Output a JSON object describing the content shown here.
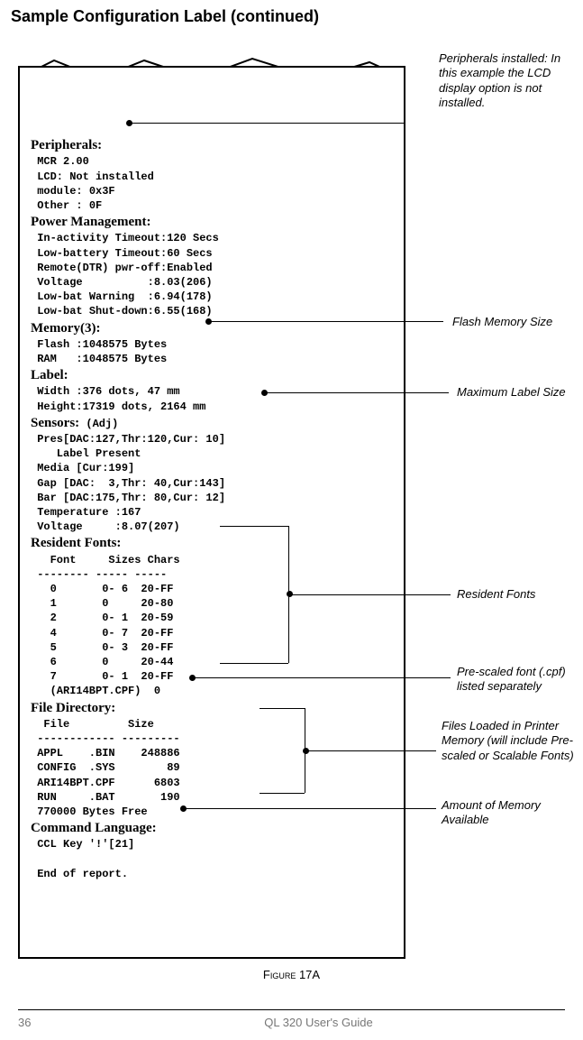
{
  "page": {
    "title": "Sample Configuration Label (continued)",
    "figure_caption_prefix": "Figure",
    "figure_caption_num": " 17A",
    "page_number": "36",
    "footer_text": "QL 320 User's Guide"
  },
  "report": {
    "peripherals": {
      "heading": "Peripherals:",
      "lines": {
        "mcr": "MCR 2.00",
        "lcd": "LCD: Not installed",
        "module": "module: 0x3F",
        "other": "Other : 0F"
      }
    },
    "power": {
      "heading": "Power Management:",
      "lines": {
        "inact": "In-activity Timeout:120 Secs",
        "lowbat": "Low-battery Timeout:60 Secs",
        "remote": "Remote(DTR) pwr-off:Enabled",
        "voltage": "Voltage          :8.03(206)",
        "warn": "Low-bat Warning  :6.94(178)",
        "shut": "Low-bat Shut-down:6.55(168)"
      }
    },
    "memory": {
      "heading": "Memory(3):",
      "lines": {
        "flash": "Flash :1048575 Bytes",
        "ram": "RAM   :1048575 Bytes"
      }
    },
    "label": {
      "heading": "Label:",
      "lines": {
        "width": "Width :376 dots, 47 mm",
        "height": "Height:17319 dots, 2164 mm"
      }
    },
    "sensors": {
      "heading": "Sensors:",
      "suffix": " (Adj)",
      "lines": {
        "pres": "Pres[DAC:127,Thr:120,Cur: 10]",
        "lp": "   Label Present",
        "media": "Media [Cur:199]",
        "gap": "Gap [DAC:  3,Thr: 40,Cur:143]",
        "bar": "Bar [DAC:175,Thr: 80,Cur: 12]",
        "temp": "Temperature :167",
        "volt": "Voltage     :8.07(207)"
      }
    },
    "fonts": {
      "heading": "Resident Fonts:",
      "header": "   Font     Sizes Chars",
      "divider": " -------- ----- -----",
      "rows": {
        "r0": "   0       0- 6  20-FF",
        "r1": "   1       0     20-80",
        "r2": "   2       0- 1  20-59",
        "r4": "   4       0- 7  20-FF",
        "r5": "   5       0- 3  20-FF",
        "r6": "   6       0     20-44",
        "r7": "   7       0- 1  20-FF"
      },
      "cpf": "   (ARI14BPT.CPF)  0"
    },
    "filedir": {
      "heading": "File Directory:",
      "header": "  File         Size",
      "divider": " ------------ ---------",
      "rows": {
        "appl": " APPL    .BIN    248886",
        "config": " CONFIG  .SYS        89",
        "ari": " ARI14BPT.CPF      6803",
        "run": " RUN     .BAT       190"
      },
      "free": " 770000 Bytes Free"
    },
    "cmdlang": {
      "heading": "Command Language:",
      "line": "CCL Key '!'[21]"
    },
    "end": "End of report."
  },
  "annotations": {
    "peripherals": "Peripherals installed: In this example the LCD display option is not installed.",
    "flash": "Flash Memory Size",
    "maxlabel": "Maximum Label Size",
    "resfonts": "Resident Fonts",
    "cpf": "Pre-scaled font (.cpf) listed separately",
    "files": "Files Loaded in Printer Memory (will include Pre-scaled or Scalable Fonts)",
    "memfree": "Amount of Memory Available"
  }
}
